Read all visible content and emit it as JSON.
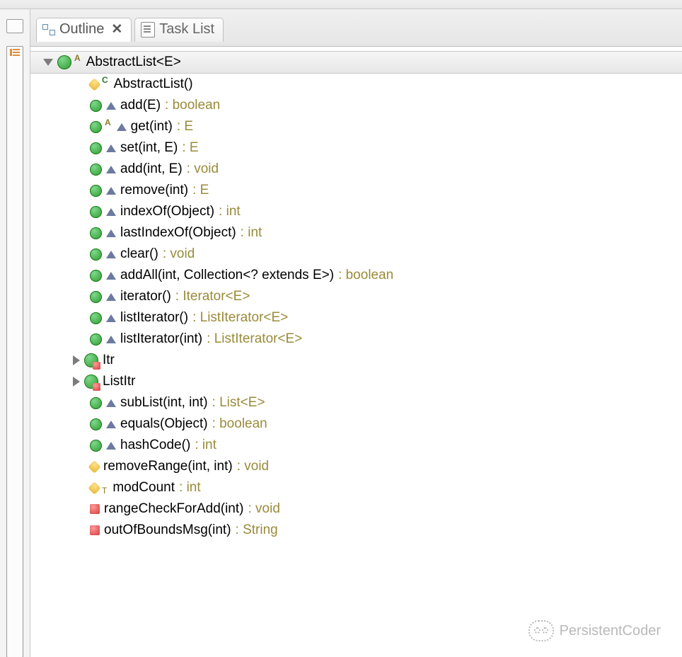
{
  "tabs": {
    "outline": "Outline",
    "tasklist": "Task List"
  },
  "root": {
    "label": "AbstractList<E>"
  },
  "members": [
    {
      "icon": "protected",
      "badge": "C",
      "sig": "AbstractList()",
      "ret": ""
    },
    {
      "icon": "public",
      "tri": true,
      "sig": "add(E)",
      "ret": " : boolean"
    },
    {
      "icon": "public",
      "badge": "A",
      "tri": true,
      "sig": "get(int)",
      "ret": " : E"
    },
    {
      "icon": "public",
      "tri": true,
      "sig": "set(int, E)",
      "ret": " : E"
    },
    {
      "icon": "public",
      "tri": true,
      "sig": "add(int, E)",
      "ret": " : void"
    },
    {
      "icon": "public",
      "tri": true,
      "sig": "remove(int)",
      "ret": " : E"
    },
    {
      "icon": "public",
      "tri": true,
      "sig": "indexOf(Object)",
      "ret": " : int"
    },
    {
      "icon": "public",
      "tri": true,
      "sig": "lastIndexOf(Object)",
      "ret": " : int"
    },
    {
      "icon": "public",
      "tri": true,
      "sig": "clear()",
      "ret": " : void"
    },
    {
      "icon": "public",
      "tri": true,
      "sig": "addAll(int, Collection<? extends E>)",
      "ret": " : boolean"
    },
    {
      "icon": "public",
      "tri": true,
      "sig": "iterator()",
      "ret": " : Iterator<E>"
    },
    {
      "icon": "public",
      "tri": true,
      "sig": "listIterator()",
      "ret": " : ListIterator<E>"
    },
    {
      "icon": "public",
      "tri": true,
      "sig": "listIterator(int)",
      "ret": " : ListIterator<E>"
    },
    {
      "icon": "inner-class",
      "twisty": "closed",
      "sig": "Itr",
      "ret": ""
    },
    {
      "icon": "inner-class",
      "twisty": "closed",
      "sig": "ListItr",
      "ret": ""
    },
    {
      "icon": "public",
      "tri": true,
      "sig": "subList(int, int)",
      "ret": " : List<E>"
    },
    {
      "icon": "public",
      "tri": true,
      "sig": "equals(Object)",
      "ret": " : boolean"
    },
    {
      "icon": "public",
      "tri": true,
      "sig": "hashCode()",
      "ret": " : int"
    },
    {
      "icon": "protected",
      "sig": "removeRange(int, int)",
      "ret": " : void"
    },
    {
      "icon": "field-protected",
      "badge": "T",
      "sig": "modCount",
      "ret": " : int"
    },
    {
      "icon": "private",
      "sig": "rangeCheckForAdd(int)",
      "ret": " : void"
    },
    {
      "icon": "private",
      "sig": "outOfBoundsMsg(int)",
      "ret": " : String"
    }
  ],
  "watermark": "PersistentCoder"
}
